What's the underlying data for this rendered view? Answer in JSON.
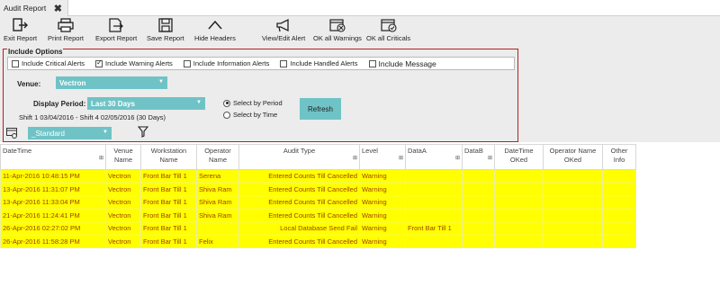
{
  "tab": {
    "title": "Audit Report"
  },
  "toolbar": {
    "items": [
      {
        "label": "Exit Report",
        "icon": "exit-icon"
      },
      {
        "label": "Print Report",
        "icon": "print-icon"
      },
      {
        "label": "Export Report",
        "icon": "export-icon"
      },
      {
        "label": "Save Report",
        "icon": "save-icon"
      },
      {
        "label": "Hide Headers",
        "icon": "chevron-up-icon"
      },
      {
        "label": "View/Edit Alert",
        "icon": "megaphone-icon"
      },
      {
        "label": "OK all Warnings",
        "icon": "calendar-x-icon"
      },
      {
        "label": "OK all Criticals",
        "icon": "calendar-check-icon"
      }
    ]
  },
  "options": {
    "title": "Include Options",
    "checkboxes": [
      {
        "label": "Include Critical Alerts",
        "checked": false
      },
      {
        "label": "Include Warning Alerts",
        "checked": true
      },
      {
        "label": "Include Information Alerts",
        "checked": false
      },
      {
        "label": "Include Handled Alerts",
        "checked": false
      },
      {
        "label": "Include  Message",
        "checked": false
      }
    ],
    "venue_label": "Venue:",
    "venue_value": "Vectron",
    "period_label": "Display Period:",
    "period_value": "Last 30 Days",
    "shift_text": "Shift 1 03/04/2016 - Shift 4 02/05/2016 (30 Days)",
    "radio_period": "Select by Period",
    "radio_time": "Select  by Time",
    "refresh_label": "Refresh",
    "layout_value": "_Standard"
  },
  "table": {
    "headers": [
      "DateTime",
      "Venue Name",
      "Workstation Name",
      "Operator Name",
      "Audit Type",
      "Level",
      "DataA",
      "DataB",
      "DateTime OKed",
      "Operator Name OKed",
      "Other Info"
    ],
    "rows": [
      [
        "11-Apr-2016 10:48:15 PM",
        "Vectron",
        "Front Bar Till 1",
        "Serena",
        "Entered Counts Till Cancelled",
        "Warning",
        "",
        "",
        "",
        "",
        ""
      ],
      [
        "13-Apr-2016 11:31:07 PM",
        "Vectron",
        "Front Bar Till 1",
        "Shiva  Ram",
        "Entered Counts Till Cancelled",
        "Warning",
        "",
        "",
        "",
        "",
        ""
      ],
      [
        "13-Apr-2016 11:33:04 PM",
        "Vectron",
        "Front Bar Till 1",
        "Shiva  Ram",
        "Entered Counts Till Cancelled",
        "Warning",
        "",
        "",
        "",
        "",
        ""
      ],
      [
        "21-Apr-2016 11:24:41 PM",
        "Vectron",
        "Front Bar Till 1",
        "Shiva  Ram",
        "Entered Counts Till Cancelled",
        "Warning",
        "",
        "",
        "",
        "",
        ""
      ],
      [
        "26-Apr-2016 02:27:02 PM",
        "Vectron",
        "Front Bar Till 1",
        "",
        "Local Database Send Fail",
        "Warning",
        "Front Bar Till 1",
        "",
        "",
        "",
        ""
      ],
      [
        "26-Apr-2016 11:58:28 PM",
        "Vectron",
        "Front Bar Till 1",
        "Felix",
        "Entered Counts Till Cancelled",
        "Warning",
        "",
        "",
        "",
        "",
        ""
      ]
    ]
  }
}
